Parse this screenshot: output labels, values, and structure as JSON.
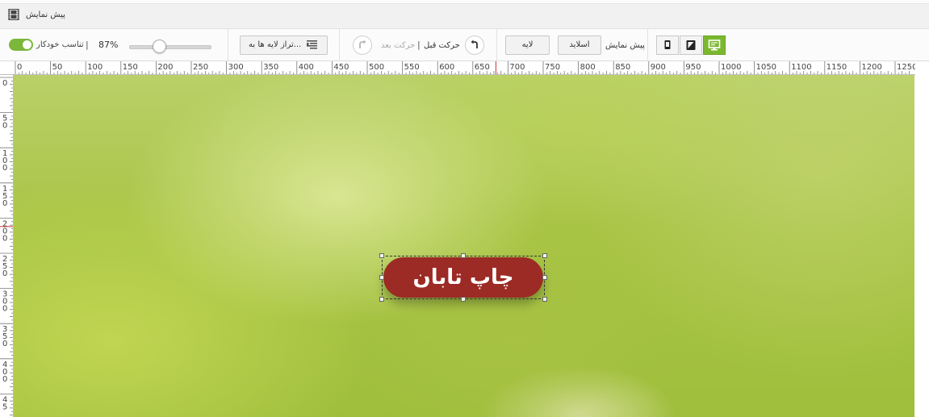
{
  "window": {
    "title": "پیش نمایش",
    "title_icon": "film-icon"
  },
  "toolbar": {
    "autofit_label": "تناسب خودکار",
    "autofit_on": true,
    "zoom_label": "87%",
    "zoom_value_percent": 87,
    "align_layers_label": "تراز لایه ها به...",
    "redo_label": "حرکت بعد",
    "undo_label": "حرکت قبل",
    "layer_button_label": "لایه",
    "slide_button_label": "اسلاید",
    "preview_label": "پیش نمایش",
    "device_modes": [
      "mobile",
      "tablet",
      "desktop"
    ],
    "active_device": "desktop",
    "accent_color": "#7cb82f"
  },
  "rulers": {
    "top_labels": [
      "0",
      "50",
      "100",
      "150",
      "200",
      "250",
      "300",
      "350",
      "400",
      "450",
      "500",
      "550",
      "600",
      "650",
      "700",
      "750",
      "800",
      "850",
      "900",
      "950",
      "1000",
      "1050",
      "1100",
      "1150",
      "1200",
      "1250"
    ],
    "left_labels": [
      "0",
      "50",
      "100",
      "150",
      "200",
      "250",
      "300",
      "350",
      "400",
      "450"
    ]
  },
  "canvas": {
    "layer_text": "چاپ تابان",
    "layer_color": "#9c2a25",
    "background": "blurred green bokeh image"
  }
}
